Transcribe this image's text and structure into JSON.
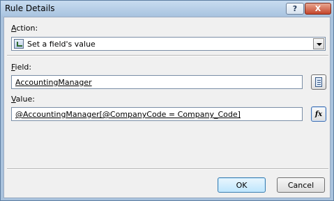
{
  "window": {
    "title": "Rule Details",
    "help_glyph": "?",
    "close_glyph": "X"
  },
  "action": {
    "label_accel": "A",
    "label_rest": "ction:",
    "value": "Set a field's value"
  },
  "field": {
    "label_accel": "F",
    "label_rest": "ield:",
    "value": "AccountingManager"
  },
  "value": {
    "label_accel": "V",
    "label_rest": "alue:",
    "value": "@AccountingManager[@CompanyCode = Company_Code]"
  },
  "buttons": {
    "ok": "OK",
    "cancel": "Cancel",
    "formula_glyph": "fx"
  },
  "icons": {
    "action": "rule-action-icon",
    "field_picker": "field-tree-icon",
    "formula": "fx-icon"
  }
}
